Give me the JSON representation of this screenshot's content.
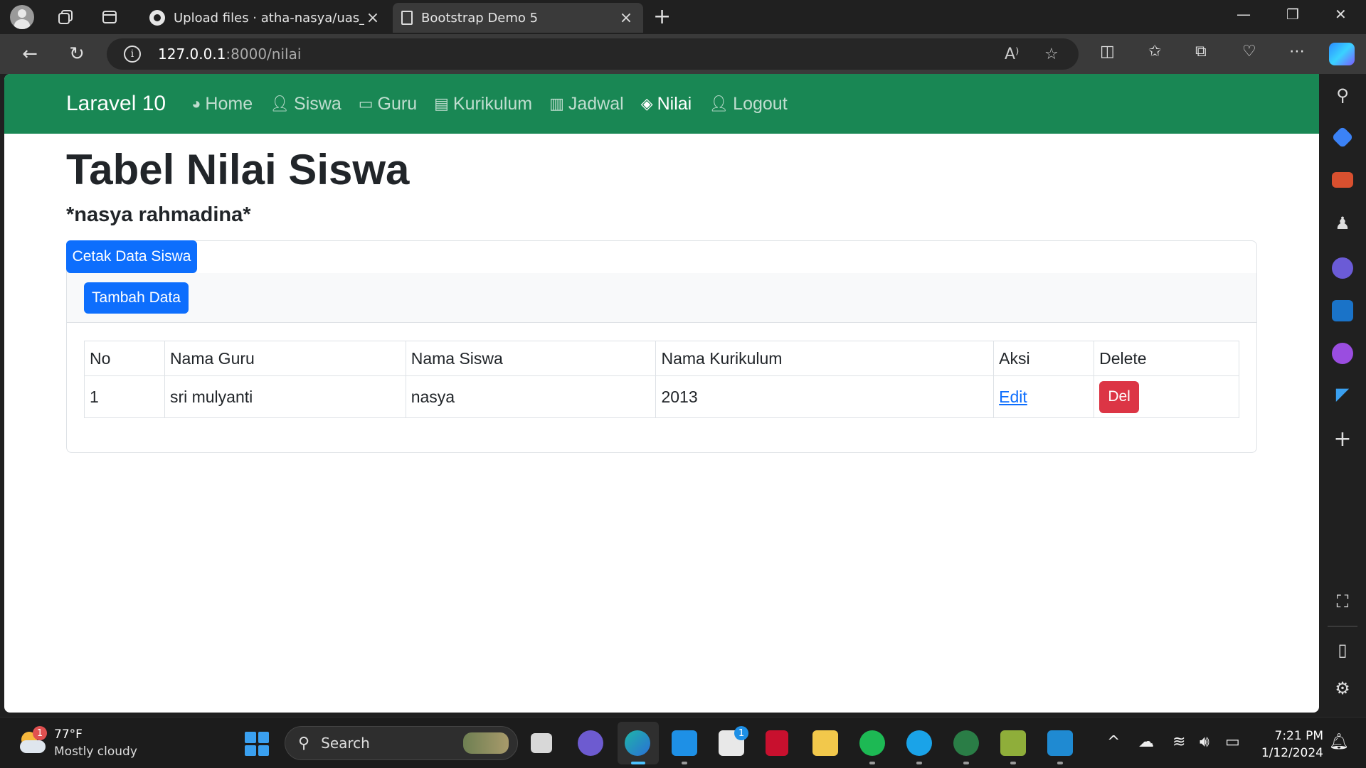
{
  "browser": {
    "tabs": [
      {
        "title": "Upload files · atha-nasya/uas_nas",
        "active": false
      },
      {
        "title": "Bootstrap Demo 5",
        "active": true
      }
    ],
    "address": {
      "host": "127.0.0.1",
      "path": ":8000/nilai"
    }
  },
  "navbar": {
    "brand": "Laravel 10",
    "links": [
      {
        "label": "Home",
        "icon": "dashboard-icon"
      },
      {
        "label": "Siswa",
        "icon": "user-icon"
      },
      {
        "label": "Guru",
        "icon": "chalkboard-teacher-icon"
      },
      {
        "label": "Kurikulum",
        "icon": "book-icon"
      },
      {
        "label": "Jadwal",
        "icon": "clipboard-icon"
      },
      {
        "label": "Nilai",
        "icon": "layers-icon",
        "active": true
      },
      {
        "label": "Logout",
        "icon": "user-icon"
      }
    ]
  },
  "page": {
    "title": "Tabel Nilai Siswa",
    "subtitle": "*nasya rahmadina*",
    "cetak_label": "Cetak Data Siswa",
    "tambah_label": "Tambah Data"
  },
  "table": {
    "headers": [
      "No",
      "Nama Guru",
      "Nama Siswa",
      "Nama Kurikulum",
      "Aksi",
      "Delete"
    ],
    "rows": [
      {
        "no": "1",
        "guru": "sri mulyanti",
        "siswa": "nasya",
        "kurikulum": "2013",
        "edit": "Edit",
        "del": "Del"
      }
    ]
  },
  "taskbar": {
    "weather_temp": "77°F",
    "weather_desc": "Mostly cloudy",
    "weather_badge": "1",
    "search_label": "Search",
    "store_badge": "1",
    "time": "7:21 PM",
    "date": "1/12/2024"
  },
  "colors": {
    "navbar": "#198754",
    "primary": "#0d6efd",
    "danger": "#dc3545"
  }
}
